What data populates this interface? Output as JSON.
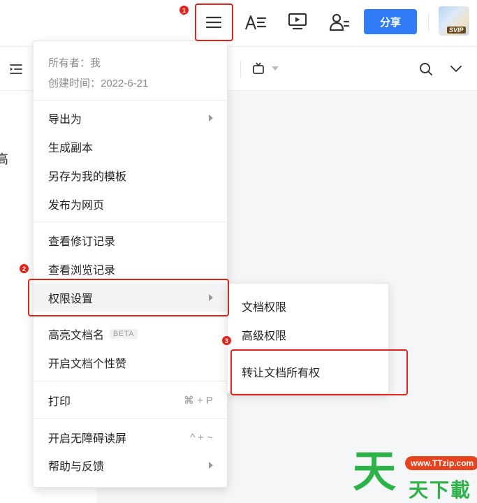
{
  "topbar": {
    "share_label": "分享",
    "vip_label": "SVIP"
  },
  "menu": {
    "owner": "所有者：我",
    "created": "创建时间：2022-6-21",
    "groups": [
      [
        "导出为",
        "生成副本",
        "另存为我的模板",
        "发布为网页"
      ],
      [
        "查看修订记录",
        "查看浏览记录",
        "权限设置"
      ],
      [
        "高亮文档名",
        "开启文档个性赞"
      ],
      [
        "打印"
      ],
      [
        "开启无障碍读屏",
        "帮助与反馈"
      ]
    ],
    "beta_label": "BETA",
    "print_shortcut": "⌘ + P",
    "accessibility_shortcut": "^ + ~"
  },
  "submenu": {
    "items": [
      "文档权限",
      "高级权限",
      "转让文档所有权"
    ]
  },
  "annotations": {
    "badge1": "1",
    "badge2": "2",
    "badge3": "3"
  },
  "doc": {
    "partial_char": "高"
  },
  "watermark": {
    "logo": "天",
    "url": "www.TTzip.com",
    "text": "天下載"
  },
  "colors": {
    "accent": "#2f7cf6",
    "annotation": "#e1231b",
    "watermark_green": "#2db34a"
  },
  "icons": [
    "menu-icon",
    "font-style-icon",
    "present-icon",
    "collaborator-icon",
    "outline-icon",
    "template-icon",
    "search-icon",
    "chevron-down-icon"
  ]
}
